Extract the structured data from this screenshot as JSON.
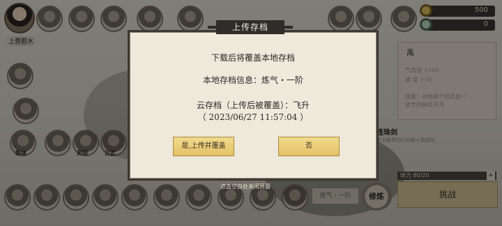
{
  "dialog": {
    "title": "上传存档",
    "line1": "下载后将覆盖本地存档",
    "line2": "本地存档信息：炼气・一阶",
    "line3": "云存档（上传后被覆盖）：飞升",
    "line4": "（ 2023/06/27 11:57:04 ）",
    "confirm_label": "是,上传并覆盖",
    "cancel_label": "否"
  },
  "close_hint": "点击空白处关闭界面",
  "player": {
    "name": "上善若水"
  },
  "resources": {
    "currency1": "500",
    "currency2": "0"
  },
  "right_panel": {
    "title": "禹",
    "stat1": "气血值 +500",
    "stat2": "速 度 +10",
    "desc1": "技能：对修敌十回击出一",
    "desc2": "道专的神兵开月"
  },
  "skill": {
    "title": "连珠剑",
    "desc": "术大概率的打对敌人造成伤"
  },
  "power": {
    "text": "体力 80/20",
    "plus": "+"
  },
  "buttons": {
    "challenge": "挑战",
    "practice": "修炼",
    "realm": "炼气・一阶"
  },
  "icon_labels": {
    "icon1": "炼体",
    "icon2": "汉武",
    "icon3": "灵阳"
  }
}
